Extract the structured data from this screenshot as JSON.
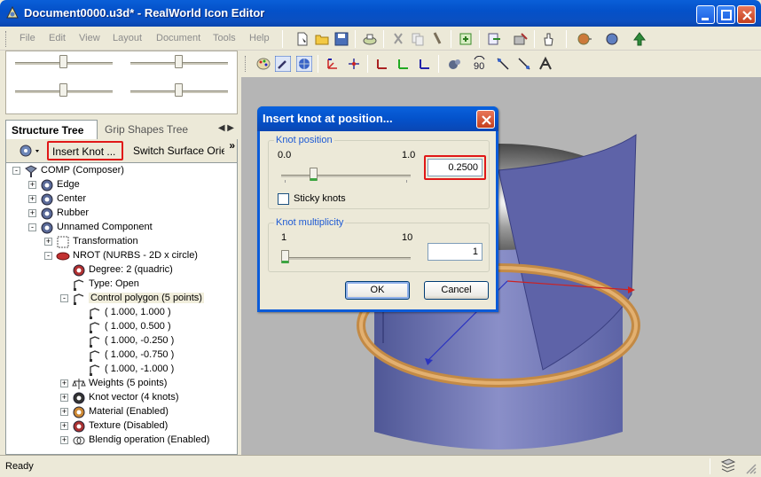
{
  "window": {
    "title": "Document0000.u3d* - RealWorld Icon Editor"
  },
  "menu": [
    "File",
    "Edit",
    "View",
    "Layout",
    "Document",
    "Tools",
    "Help"
  ],
  "tabs": {
    "structure": "Structure Tree",
    "grip": "Grip Shapes Tree"
  },
  "tree_toolbar": {
    "insert_knot": "Insert Knot ...",
    "switch_surface": "Switch Surface Orier"
  },
  "tree": [
    {
      "label": "COMP (Composer)",
      "icon": "composer-icon",
      "expander": "-"
    },
    {
      "label": "Edge",
      "icon": "component-icon",
      "expander": "+"
    },
    {
      "label": "Center",
      "icon": "component-icon",
      "expander": "+"
    },
    {
      "label": "Rubber",
      "icon": "component-icon",
      "expander": "+"
    },
    {
      "label": "Unnamed Component",
      "icon": "component-icon",
      "expander": "-"
    },
    {
      "label": "Transformation",
      "icon": "transformation-icon",
      "expander": "+"
    },
    {
      "label": "NROT (NURBS - 2D x circle)",
      "icon": "nurbs-icon",
      "expander": "-"
    },
    {
      "label": "Degree: 2 (quadric)",
      "icon": "degree-icon",
      "expander": ""
    },
    {
      "label": "Type: Open",
      "icon": "type-icon",
      "expander": ""
    },
    {
      "label": "Control polygon (5 points)",
      "icon": "polygon-icon",
      "expander": "-"
    },
    {
      "label": "( 1.000, 1.000 )",
      "icon": "point-icon",
      "expander": ""
    },
    {
      "label": "( 1.000, 0.500 )",
      "icon": "point-icon",
      "expander": ""
    },
    {
      "label": "( 1.000, -0.250 )",
      "icon": "point-icon",
      "expander": ""
    },
    {
      "label": "( 1.000, -0.750 )",
      "icon": "point-icon",
      "expander": ""
    },
    {
      "label": "( 1.000, -1.000 )",
      "icon": "point-icon",
      "expander": ""
    },
    {
      "label": "Weights (5 points)",
      "icon": "weights-icon",
      "expander": "+"
    },
    {
      "label": "Knot vector (4 knots)",
      "icon": "knot-icon",
      "expander": "+"
    },
    {
      "label": "Material (Enabled)",
      "icon": "material-icon",
      "expander": "+"
    },
    {
      "label": "Texture (Disabled)",
      "icon": "texture-icon",
      "expander": "+"
    },
    {
      "label": "Blendig operation (Enabled)",
      "icon": "blend-icon",
      "expander": "+"
    }
  ],
  "dialog": {
    "title": "Insert knot at position...",
    "knot_position_label": "Knot position",
    "pos_min": "0.0",
    "pos_max": "1.0",
    "pos_value": "0.2500",
    "sticky_label": "Sticky knots",
    "multiplicity_label": "Knot multiplicity",
    "mult_min": "1",
    "mult_max": "10",
    "mult_value": "1",
    "ok": "OK",
    "cancel": "Cancel"
  },
  "status": {
    "text": "Ready"
  }
}
